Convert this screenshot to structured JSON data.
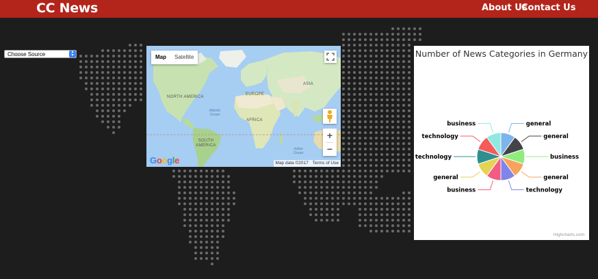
{
  "header": {
    "brand": "CC News",
    "nav": [
      "About Us",
      "Contact Us"
    ]
  },
  "source_select": {
    "value": "Choose Source",
    "icon": "up-down-arrows-icon"
  },
  "map": {
    "tabs": [
      "Map",
      "Satellite"
    ],
    "active_tab": "Map",
    "continents": [
      "NORTH AMERICA",
      "SOUTH AMERICA",
      "EUROPE",
      "AFRICA",
      "ASIA"
    ],
    "oceans": [
      "Atlantic Ocean",
      "Indian Ocean"
    ],
    "logo": "Google",
    "attribution": [
      "Map data ©2017",
      "Terms of Use"
    ],
    "zoom_in": "+",
    "zoom_out": "−",
    "icons": [
      "fullscreen-icon",
      "pegman-icon"
    ]
  },
  "colors": {
    "header": "#b3241a",
    "background": "#1d1d1d",
    "dots": "#6b6b6b"
  },
  "chart_data": {
    "type": "pie",
    "title": "Number of News Categories in Germany",
    "credits": "Highcharts.com",
    "slices": [
      {
        "label": "general",
        "value": 1,
        "color": "#7cb5ec"
      },
      {
        "label": "general",
        "value": 1,
        "color": "#434348"
      },
      {
        "label": "business",
        "value": 1,
        "color": "#90ed7d"
      },
      {
        "label": "general",
        "value": 1,
        "color": "#f7a35c"
      },
      {
        "label": "technology",
        "value": 1,
        "color": "#8085e9"
      },
      {
        "label": "business",
        "value": 1,
        "color": "#f15c80"
      },
      {
        "label": "general",
        "value": 1,
        "color": "#e4d354"
      },
      {
        "label": "technology",
        "value": 1,
        "color": "#2b908f"
      },
      {
        "label": "technology",
        "value": 1,
        "color": "#f45b5b"
      },
      {
        "label": "business",
        "value": 1,
        "color": "#91e8e1"
      }
    ]
  }
}
